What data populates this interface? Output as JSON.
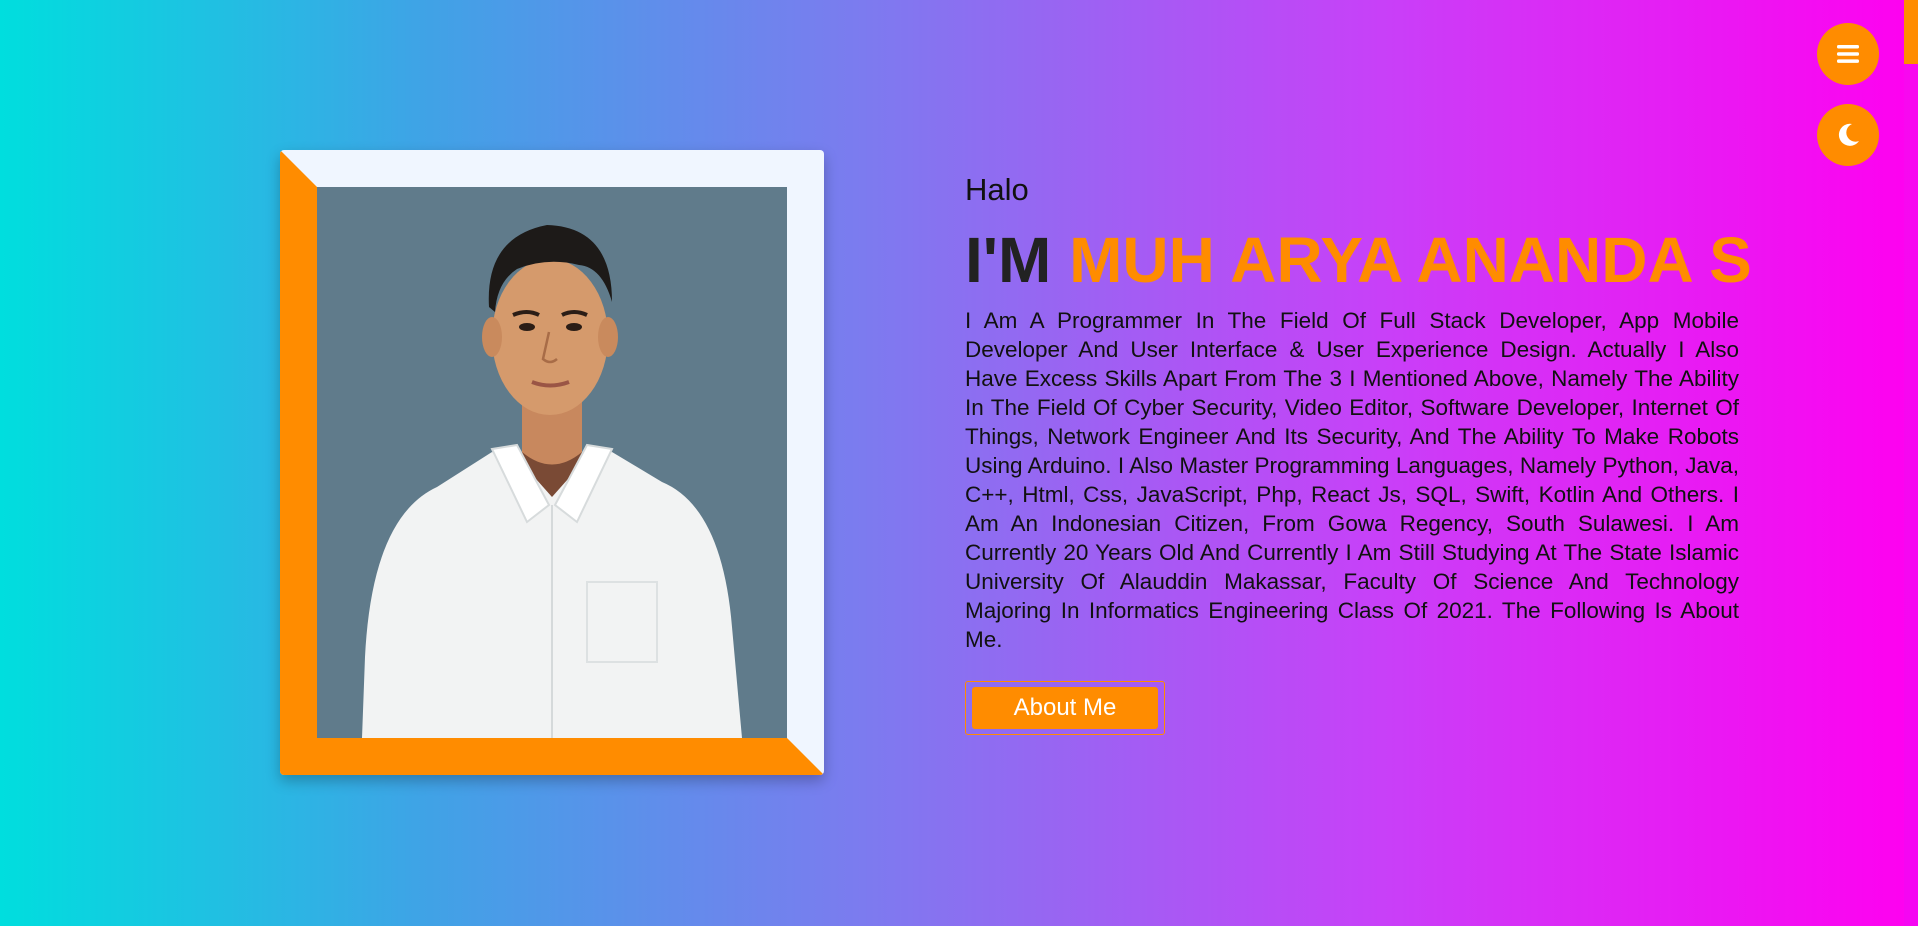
{
  "hero": {
    "greeting": "Halo",
    "headline_prefix": "I'M",
    "headline_name": "MUH ARYA ANANDA S",
    "description": "I Am A Programmer In The Field Of Full Stack Developer, App Mobile Developer And User Interface & User Experience Design. Actually I Also Have Excess Skills Apart From The 3 I Mentioned Above, Namely The Ability In The Field Of Cyber Security, Video Editor, Software Developer, Internet Of Things, Network Engineer And Its Security, And The Ability To Make Robots Using Arduino. I Also Master Programming Languages, Namely Python, Java, C++, Html, Css, JavaScript, Php, React Js, SQL, Swift, Kotlin And Others. I Am An Indonesian Citizen, From Gowa Regency, South Sulawesi. I Am Currently 20 Years Old And Currently I Am Still Studying At The State Islamic University Of Alauddin Makassar, Faculty Of Science And Technology Majoring In Informatics Engineering Class Of 2021. The Following Is About Me.",
    "about_button": "About Me"
  },
  "icons": {
    "menu": "hamburger-menu-icon",
    "theme": "moon-icon"
  },
  "colors": {
    "accent": "#ff8c00",
    "frame_light": "#f0f6ff",
    "photo_bg": "#607b8b",
    "gradient_start": "#00dede",
    "gradient_end": "#ff00f0"
  }
}
